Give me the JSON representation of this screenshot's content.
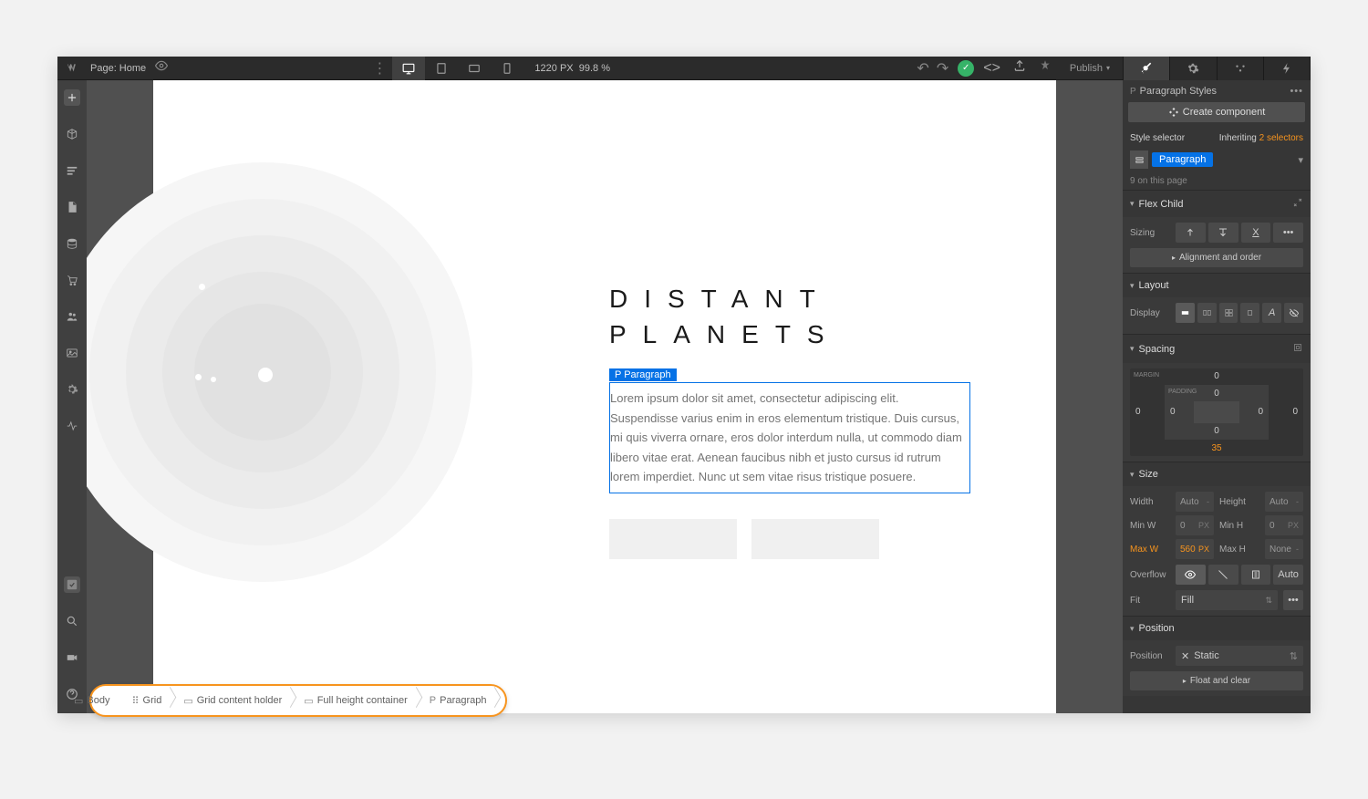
{
  "topbar": {
    "page_label": "Page: Home",
    "viewport_width": "1220",
    "viewport_unit": "PX",
    "zoom": "99.8",
    "zoom_unit": "%",
    "publish_label": "Publish"
  },
  "canvas": {
    "title_line1": "DISTANT",
    "title_line2": "PLANETS",
    "selected_tag": "P  Paragraph",
    "paragraph_text": "Lorem ipsum dolor sit amet, consectetur adipiscing elit. Suspendisse varius enim in eros elementum tristique. Duis cursus, mi quis viverra ornare, eros dolor interdum nulla, ut commodo diam libero vitae erat. Aenean faucibus nibh et justo cursus id rutrum lorem imperdiet. Nunc ut sem vitae risus tristique posuere."
  },
  "breadcrumbs": [
    "Body",
    "Grid",
    "Grid content holder",
    "Full height container",
    "Paragraph"
  ],
  "breadcrumb_icons": [
    "▭",
    "⠿",
    "▭",
    "▭",
    "P"
  ],
  "styles_panel": {
    "header": "Paragraph Styles",
    "create_component": "Create component",
    "style_selector_label": "Style selector",
    "inheriting_label": "Inheriting",
    "inheriting_count": "2 selectors",
    "selector_tag": "Paragraph",
    "count_label": "9 on this page",
    "sections": {
      "flex_child": {
        "title": "Flex Child",
        "sizing_label": "Sizing",
        "alignment_btn": "Alignment and order"
      },
      "layout": {
        "title": "Layout",
        "display_label": "Display"
      },
      "spacing": {
        "title": "Spacing",
        "margin_label": "MARGIN",
        "padding_label": "PADDING",
        "margin": {
          "top": "0",
          "right": "0",
          "bottom": "35",
          "left": "0"
        },
        "padding": {
          "top": "0",
          "right": "0",
          "bottom": "0",
          "left": "0"
        }
      },
      "size": {
        "title": "Size",
        "width_label": "Width",
        "height_label": "Height",
        "minw_label": "Min W",
        "minh_label": "Min H",
        "maxw_label": "Max W",
        "maxh_label": "Max H",
        "width": "Auto",
        "height": "Auto",
        "minw": "0",
        "minh": "0",
        "maxw": "560",
        "maxh": "None",
        "px": "PX",
        "dash": "-",
        "overflow_label": "Overflow",
        "auto_label": "Auto",
        "fit_label": "Fit",
        "fit_value": "Fill"
      },
      "position": {
        "title": "Position",
        "position_label": "Position",
        "position_value": "Static",
        "float_btn": "Float and clear"
      }
    }
  }
}
